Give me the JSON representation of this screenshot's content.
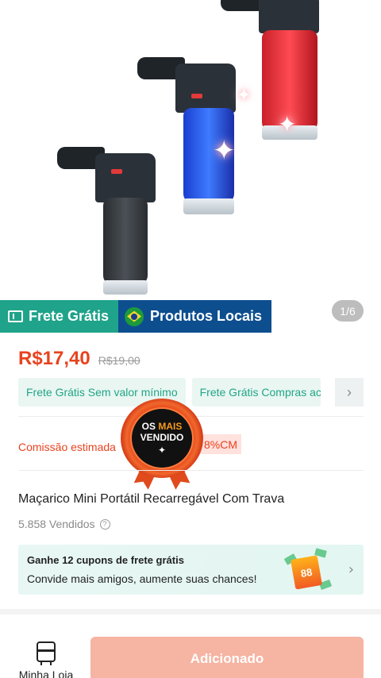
{
  "hero": {
    "image_alt": "Três maçaricos recarregáveis (preto, azul e vermelho)",
    "pager": "1/6"
  },
  "badges": {
    "free_shipping": "Frete Grátis",
    "local_products": "Produtos Locais"
  },
  "price": {
    "current": "R$17,40",
    "original": "R$19,00"
  },
  "chips": [
    {
      "label": "Frete Grátis Sem valor mínimo"
    },
    {
      "label": "Frete Grátis Compras aci"
    }
  ],
  "commission": {
    "label": "Comissão estimada",
    "tag": "8%CM"
  },
  "seal": {
    "line1_a": "OS",
    "line1_b": "MAIS",
    "line2": "VENDIDO",
    "icon": "star-icon"
  },
  "product": {
    "title": "Maçarico Mini Portátil Recarregável Com Trava",
    "sold": "5.858 Vendidos"
  },
  "coupon": {
    "title": "Ganhe 12 cupons de frete grátis",
    "subtitle": "Convide mais amigos, aumente suas chances!",
    "bag_text": "88"
  },
  "bottom_bar": {
    "store_label": "Minha Loja",
    "add_button": "Adicionado"
  },
  "colors": {
    "accent": "#e8431f",
    "green": "#1fa38a",
    "blue_badge": "#0d4e8f",
    "button_disabled": "#f6b4a2"
  }
}
